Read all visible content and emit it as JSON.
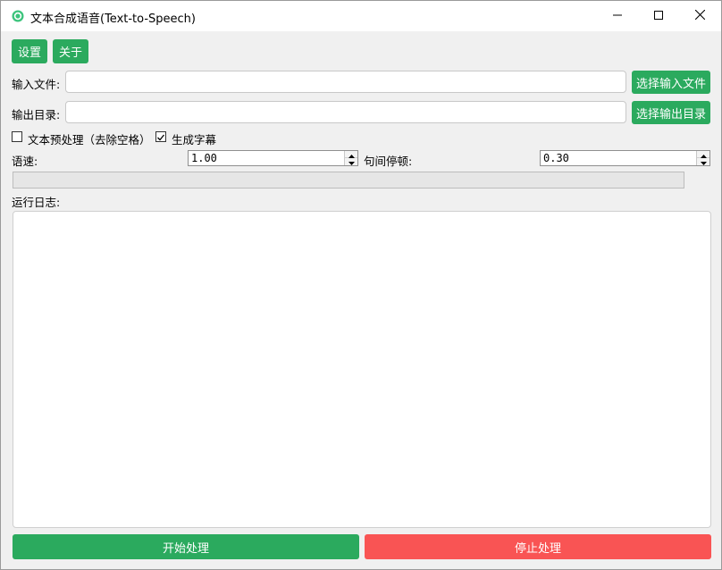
{
  "window": {
    "title": "文本合成语音(Text-to-Speech)",
    "controls": [
      "minimize-icon",
      "maximize-icon",
      "close-icon"
    ]
  },
  "toolbar": {
    "settings_label": "设置",
    "about_label": "关于"
  },
  "input_file": {
    "label": "输入文件:",
    "value": "",
    "button_label": "选择输入文件"
  },
  "output_dir": {
    "label": "输出目录:",
    "value": "",
    "button_label": "选择输出目录"
  },
  "options": {
    "preprocess_label": "文本预处理（去除空格）",
    "preprocess_checked": false,
    "subtitle_label": "生成字幕",
    "subtitle_checked": true
  },
  "speed": {
    "label": "语速:",
    "value": "1.00"
  },
  "pause": {
    "label": "句间停顿:",
    "value": "0.30"
  },
  "progress": {
    "percent": 0
  },
  "log": {
    "label": "运行日志:",
    "content": ""
  },
  "actions": {
    "start_label": "开始处理",
    "stop_label": "停止处理"
  },
  "colors": {
    "primary_green": "#2baa5e",
    "danger_red": "#f95454",
    "app_icon": "#3cc47c"
  }
}
